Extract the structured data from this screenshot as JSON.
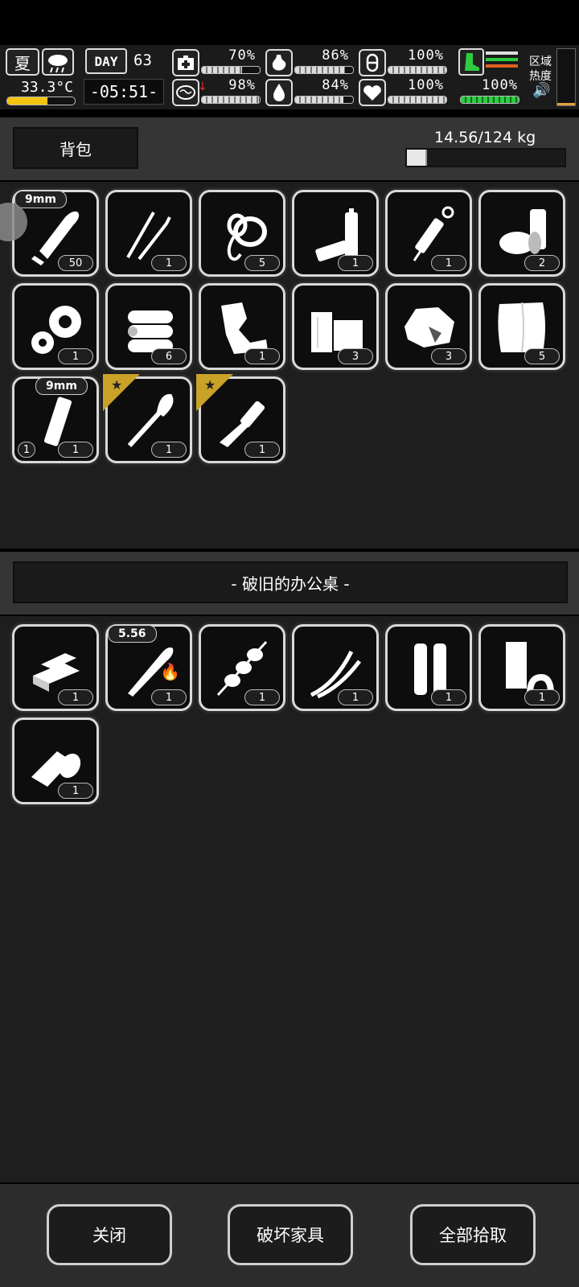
{
  "hud": {
    "season": "夏",
    "temperature": "33.3°C",
    "day_label": "DAY",
    "day_number": "63",
    "time": "-05:51-",
    "stats": [
      {
        "icon": "medkit-icon",
        "value": "70%",
        "level": 0.7
      },
      {
        "icon": "stomach-icon",
        "value": "86%",
        "level": 0.86
      },
      {
        "icon": "pill-icon",
        "value": "100%",
        "level": 1.0
      },
      {
        "icon": "brain-icon",
        "value": "98%",
        "level": 0.98
      },
      {
        "icon": "water-drop-icon",
        "value": "84%",
        "level": 0.84
      },
      {
        "icon": "heart-icon",
        "value": "100%",
        "level": 1.0
      }
    ],
    "stamina_value": "100%",
    "region_label_1": "区域",
    "region_label_2": "热度",
    "colors": {
      "green": "#2ecc40",
      "orange": "#e06020",
      "accent_yellow": "#f2c40f"
    }
  },
  "backpack": {
    "title": "背包",
    "weight": "14.56/124 kg",
    "weight_fraction": 0.117,
    "items": [
      {
        "name": "bullet-9mm",
        "icon": "bullet-icon",
        "qty": "50",
        "tag": "9mm"
      },
      {
        "name": "lockpick",
        "icon": "lockpick-icon",
        "qty": "1"
      },
      {
        "name": "rope",
        "icon": "rope-icon",
        "qty": "5"
      },
      {
        "name": "batteries",
        "icon": "battery-icon",
        "qty": "1"
      },
      {
        "name": "syringe",
        "icon": "syringe-icon",
        "qty": "1"
      },
      {
        "name": "cans",
        "icon": "can-icon",
        "qty": "2"
      },
      {
        "name": "gears",
        "icon": "gear-icon",
        "qty": "1"
      },
      {
        "name": "logs",
        "icon": "log-icon",
        "qty": "6"
      },
      {
        "name": "scrap",
        "icon": "scrap-icon",
        "qty": "1"
      },
      {
        "name": "planks",
        "icon": "plank-icon",
        "qty": "3"
      },
      {
        "name": "ore",
        "icon": "ore-icon",
        "qty": "3"
      },
      {
        "name": "cloth",
        "icon": "cloth-icon",
        "qty": "5"
      },
      {
        "name": "magazine-9mm",
        "icon": "magazine-icon",
        "qty": "1",
        "qty_left": "1",
        "tag": "9mm"
      },
      {
        "name": "shovel",
        "icon": "shovel-icon",
        "qty": "1",
        "starred": true
      },
      {
        "name": "knife",
        "icon": "knife-icon",
        "qty": "1",
        "starred": true
      }
    ]
  },
  "container": {
    "title": "- 破旧的办公桌 -",
    "items": [
      {
        "name": "metal-bars",
        "icon": "ingot-icon",
        "qty": "1"
      },
      {
        "name": "bullet-556",
        "icon": "rifle-bullet-icon",
        "qty": "1",
        "tag": "5.56",
        "fire": true
      },
      {
        "name": "kebab",
        "icon": "skewer-icon",
        "qty": "1"
      },
      {
        "name": "wires",
        "icon": "wire-icon",
        "qty": "1"
      },
      {
        "name": "tubes",
        "icon": "tube-icon",
        "qty": "1"
      },
      {
        "name": "tape-parts",
        "icon": "part-icon",
        "qty": "1"
      },
      {
        "name": "bandage-roll",
        "icon": "bandage-icon",
        "qty": "1"
      }
    ]
  },
  "buttons": {
    "close": "关闭",
    "destroy": "破坏家具",
    "take_all": "全部拾取"
  }
}
